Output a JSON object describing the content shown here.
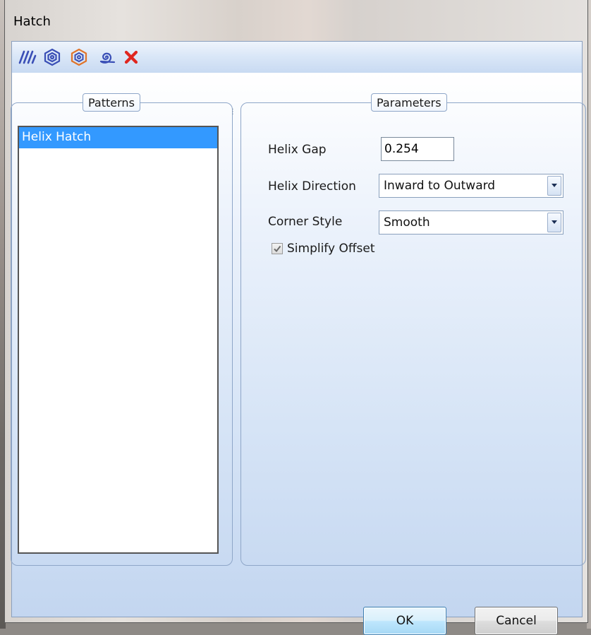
{
  "window": {
    "title": "Hatch"
  },
  "toolbar": {
    "buttons": [
      {
        "name": "parallel-hatch",
        "icon": "parallel-lines-icon",
        "color": "#3a4fb6"
      },
      {
        "name": "offset-hatch",
        "icon": "concentric-hexagon-icon",
        "color": "#3a4fb6"
      },
      {
        "name": "offset-hatch-alt",
        "icon": "concentric-hexagon-orange-icon",
        "color": "#e0742a"
      },
      {
        "name": "helix-hatch",
        "icon": "spiral-icon",
        "color": "#3a4fb6"
      },
      {
        "name": "delete-hatch",
        "icon": "red-x-icon",
        "color": "#e0261f"
      }
    ]
  },
  "patterns": {
    "label": "Patterns",
    "items": [
      {
        "label": "Helix Hatch",
        "selected": true
      }
    ]
  },
  "parameters": {
    "label": "Parameters",
    "helix_gap": {
      "label": "Helix Gap",
      "value": "0.254"
    },
    "helix_direction": {
      "label": "Helix Direction",
      "value": "Inward to Outward"
    },
    "corner_style": {
      "label": "Corner Style",
      "value": "Smooth"
    },
    "simplify_offset": {
      "label": "Simplify Offset",
      "checked": true
    }
  },
  "buttons": {
    "ok": "OK",
    "cancel": "Cancel"
  },
  "colors": {
    "accent": "#3399ff",
    "panel": "#cfe0f6"
  }
}
